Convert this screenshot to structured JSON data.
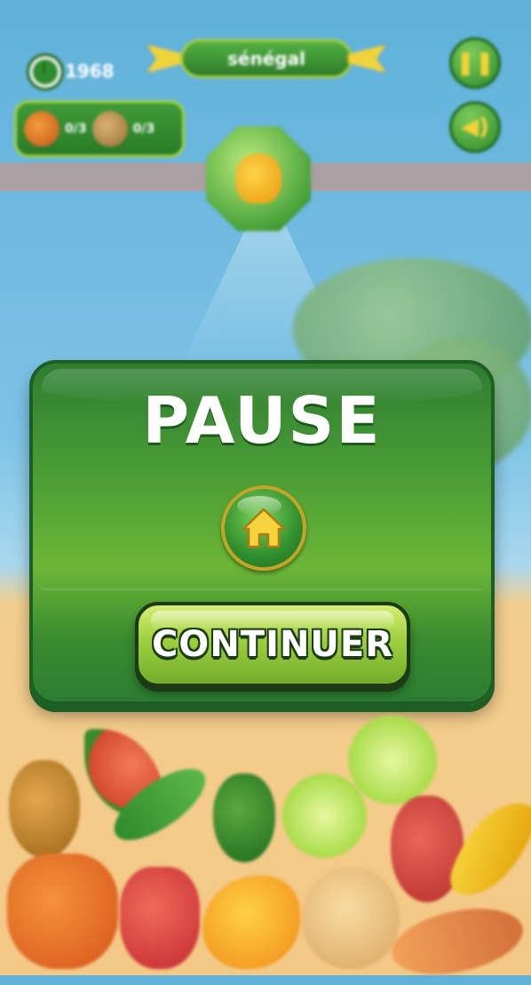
{
  "hud": {
    "score": "1968",
    "country": "sénégal",
    "targets": [
      {
        "icon": "orange-icon",
        "count": "0/3"
      },
      {
        "icon": "coconut-icon",
        "count": "0/3"
      }
    ],
    "pause_icon": "pause-icon",
    "sound_icon": "sound-icon",
    "target_fruit_icon": "pepper-icon"
  },
  "pause_panel": {
    "title": "PAUSE",
    "home_icon": "home-icon",
    "continue_label": "CONTINUER"
  },
  "colors": {
    "panel_green": "#4d9f35",
    "panel_border": "#1d5e22",
    "continue_green": "#9dcf3f",
    "home_gold": "#f3d33a"
  }
}
